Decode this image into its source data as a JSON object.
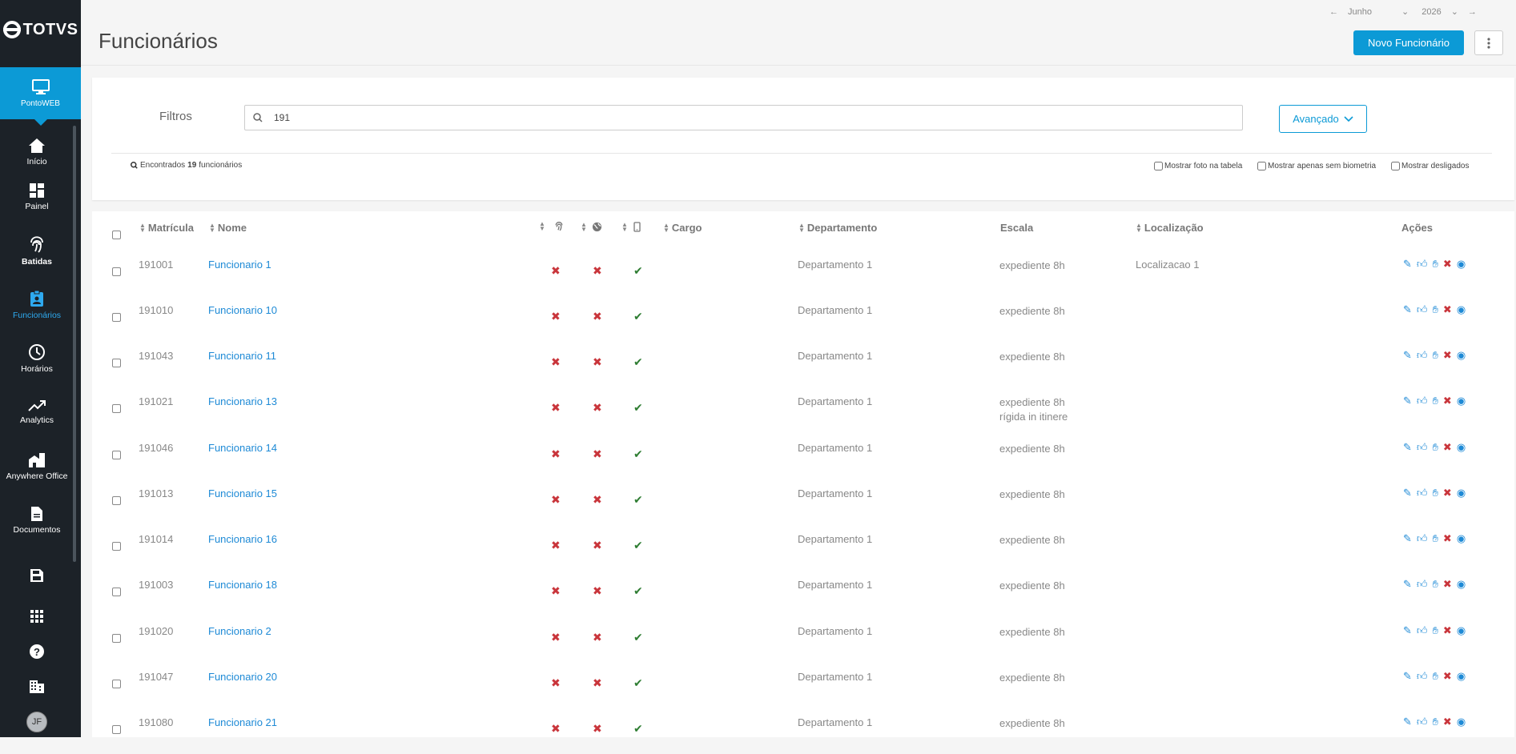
{
  "sidebar": {
    "logo": "TOTVS",
    "active": {
      "label": "PontoWEB"
    },
    "items": [
      {
        "label": "Início",
        "icon": "home-icon"
      },
      {
        "label": "Painel",
        "icon": "dashboard-icon"
      },
      {
        "label": "Batidas",
        "icon": "fingerprint-icon"
      },
      {
        "label": "Funcionários",
        "icon": "badge-icon"
      },
      {
        "label": "Horários",
        "icon": "clock-icon"
      },
      {
        "label": "Analytics",
        "icon": "trend-icon"
      },
      {
        "label": "Anywhere Office",
        "icon": "building-icon"
      },
      {
        "label": "Documentos",
        "icon": "document-icon"
      }
    ],
    "avatar": "JF"
  },
  "header": {
    "title": "Funcionários",
    "month": "Junho",
    "year": "2026",
    "new_button": "Novo Funcionário"
  },
  "filters": {
    "label": "Filtros",
    "search_value": "191",
    "advanced": "Avançado",
    "found_prefix": "Encontrados",
    "found_count": "19",
    "found_suffix": "funcionários",
    "check_photo": "Mostrar foto na tabela",
    "check_biometry": "Mostrar apenas sem biometria",
    "check_dismissed": "Mostrar desligados"
  },
  "table": {
    "headers": {
      "matricula": "Matrícula",
      "nome": "Nome",
      "cargo": "Cargo",
      "departamento": "Departamento",
      "escala": "Escala",
      "localizacao": "Localização",
      "acoes": "Ações"
    },
    "rows": [
      {
        "matricula": "191001",
        "nome": "Funcionario 1",
        "departamento": "Departamento 1",
        "escala": "expediente 8h",
        "escala2": "",
        "localizacao": "Localizacao 1"
      },
      {
        "matricula": "191010",
        "nome": "Funcionario 10",
        "departamento": "Departamento 1",
        "escala": "expediente 8h",
        "escala2": "",
        "localizacao": ""
      },
      {
        "matricula": "191043",
        "nome": "Funcionario 11",
        "departamento": "Departamento 1",
        "escala": "expediente 8h",
        "escala2": "",
        "localizacao": ""
      },
      {
        "matricula": "191021",
        "nome": "Funcionario 13",
        "departamento": "Departamento 1",
        "escala": "expediente 8h",
        "escala2": "rígida in itinere",
        "localizacao": ""
      },
      {
        "matricula": "191046",
        "nome": "Funcionario 14",
        "departamento": "Departamento 1",
        "escala": "expediente 8h",
        "escala2": "",
        "localizacao": ""
      },
      {
        "matricula": "191013",
        "nome": "Funcionario 15",
        "departamento": "Departamento 1",
        "escala": "expediente 8h",
        "escala2": "",
        "localizacao": ""
      },
      {
        "matricula": "191014",
        "nome": "Funcionario 16",
        "departamento": "Departamento 1",
        "escala": "expediente 8h",
        "escala2": "",
        "localizacao": ""
      },
      {
        "matricula": "191003",
        "nome": "Funcionario 18",
        "departamento": "Departamento 1",
        "escala": "expediente 8h",
        "escala2": "",
        "localizacao": ""
      },
      {
        "matricula": "191020",
        "nome": "Funcionario 2",
        "departamento": "Departamento 1",
        "escala": "expediente 8h",
        "escala2": "",
        "localizacao": ""
      },
      {
        "matricula": "191047",
        "nome": "Funcionario 20",
        "departamento": "Departamento 1",
        "escala": "expediente 8h",
        "escala2": "",
        "localizacao": ""
      },
      {
        "matricula": "191080",
        "nome": "Funcionario 21",
        "departamento": "Departamento 1",
        "escala": "expediente 8h",
        "escala2": "",
        "localizacao": ""
      }
    ]
  },
  "colors": {
    "accent": "#0c9ad6",
    "sidebar": "#1c2228",
    "red": "#c9353b",
    "green": "#2e7d32"
  }
}
